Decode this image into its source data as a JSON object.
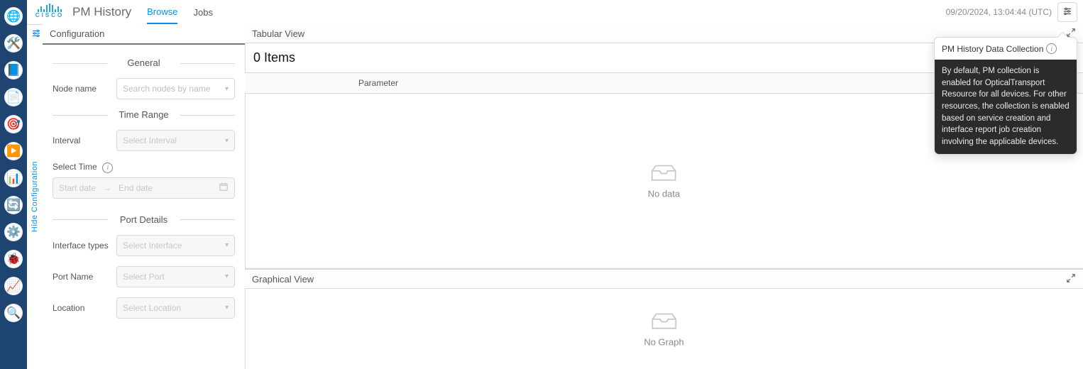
{
  "header": {
    "brand_word": "CISCO",
    "app_title": "PM History",
    "tabs": {
      "browse": "Browse",
      "jobs": "Jobs"
    },
    "timestamp": "09/20/2024, 13:04:44 (UTC)"
  },
  "hide_strip": {
    "label": "Hide Configuration"
  },
  "config": {
    "title": "Configuration",
    "general": {
      "section": "General",
      "node_name_label": "Node name",
      "node_name_placeholder": "Search nodes by name"
    },
    "time_range": {
      "section": "Time Range",
      "interval_label": "Interval",
      "interval_placeholder": "Select Interval",
      "select_time_label": "Select Time",
      "start_placeholder": "Start date",
      "end_placeholder": "End date"
    },
    "port_details": {
      "section": "Port Details",
      "interface_types_label": "Interface types",
      "interface_types_placeholder": "Select Interface",
      "port_name_label": "Port Name",
      "port_name_placeholder": "Select Port",
      "location_label": "Location",
      "location_placeholder": "Select Location"
    }
  },
  "tab_view": {
    "title": "Tabular View",
    "items_count": "0 Items",
    "col_parameter": "Parameter",
    "empty": "No data"
  },
  "graph_view": {
    "title": "Graphical View",
    "empty": "No Graph"
  },
  "popover": {
    "title": "PM History Data Collection",
    "body": "By default, PM collection is enabled for OpticalTransport Resource for all devices. For other resources, the collection is enabled based on service creation and interface report job creation involving the applicable devices."
  },
  "rail": {
    "items": [
      "◯",
      "◯",
      "◯",
      "◯",
      "◯",
      "◯",
      "◯",
      "◯",
      "◯",
      "◯",
      "◯"
    ]
  }
}
